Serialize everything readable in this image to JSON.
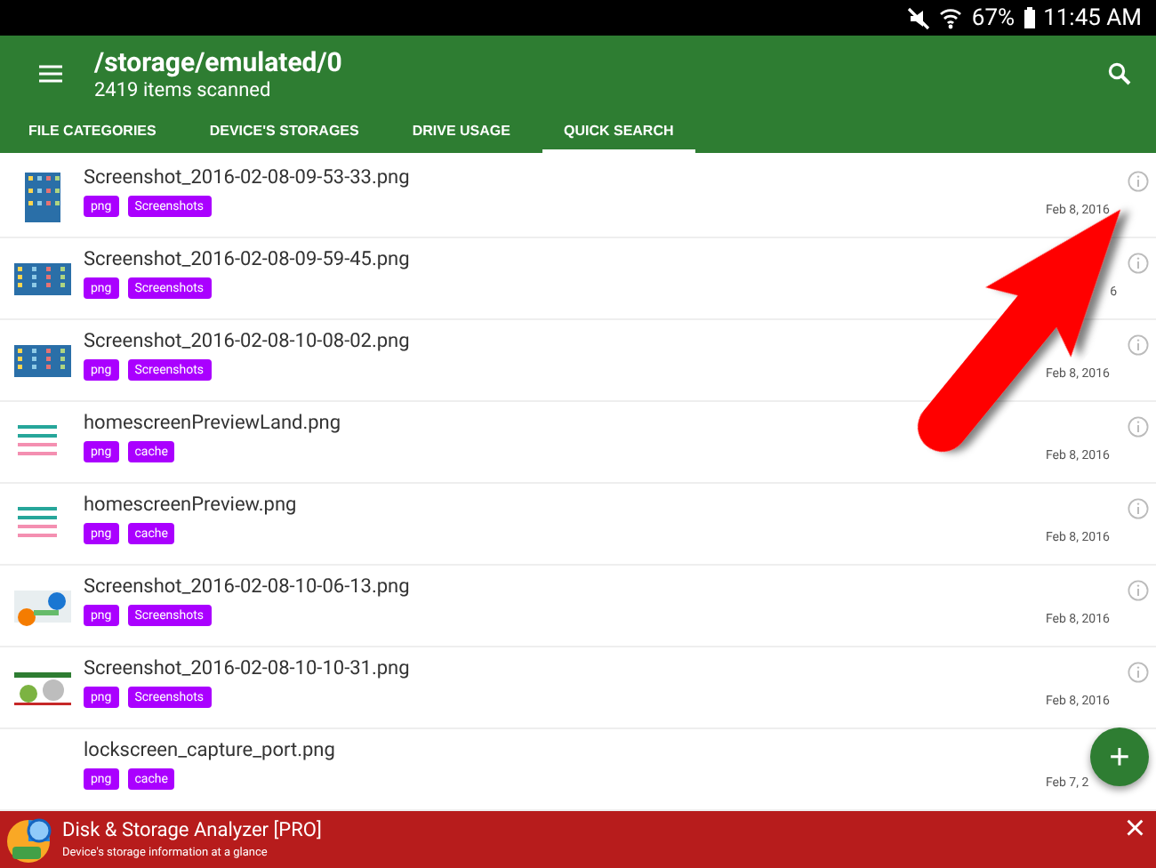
{
  "status_bar": {
    "battery": "67%",
    "time": "11:45 AM"
  },
  "toolbar": {
    "title": "/storage/emulated/0",
    "subtitle": "2419 items scanned"
  },
  "tabs": [
    {
      "label": "FILE CATEGORIES",
      "selected": false
    },
    {
      "label": "DEVICE'S STORAGES",
      "selected": false
    },
    {
      "label": "DRIVE USAGE",
      "selected": false
    },
    {
      "label": "QUICK SEARCH",
      "selected": true
    }
  ],
  "files": [
    {
      "name": "Screenshot_2016-02-08-09-53-33.png",
      "tags": [
        "png",
        "Screenshots"
      ],
      "date": "Feb 8, 2016",
      "info_icon": true
    },
    {
      "name": "Screenshot_2016-02-08-09-59-45.png",
      "tags": [
        "png",
        "Screenshots"
      ],
      "date": "6",
      "info_icon": true
    },
    {
      "name": "Screenshot_2016-02-08-10-08-02.png",
      "tags": [
        "png",
        "Screenshots"
      ],
      "date": "Feb 8, 2016",
      "info_icon": true
    },
    {
      "name": "homescreenPreviewLand.png",
      "tags": [
        "png",
        "cache"
      ],
      "date": "Feb 8, 2016",
      "info_icon": true
    },
    {
      "name": "homescreenPreview.png",
      "tags": [
        "png",
        "cache"
      ],
      "date": "Feb 8, 2016",
      "info_icon": true
    },
    {
      "name": "Screenshot_2016-02-08-10-06-13.png",
      "tags": [
        "png",
        "Screenshots"
      ],
      "date": "Feb 8, 2016",
      "info_icon": true
    },
    {
      "name": "Screenshot_2016-02-08-10-10-31.png",
      "tags": [
        "png",
        "Screenshots"
      ],
      "date": "Feb 8, 2016",
      "info_icon": true
    },
    {
      "name": "lockscreen_capture_port.png",
      "tags": [
        "png",
        "cache"
      ],
      "date": "Feb 7, 2",
      "info_icon": false
    }
  ],
  "fab": {
    "label": "+"
  },
  "banner": {
    "title": "Disk & Storage Analyzer [PRO]",
    "subtitle": "Device's storage information at a glance",
    "close": "×"
  }
}
